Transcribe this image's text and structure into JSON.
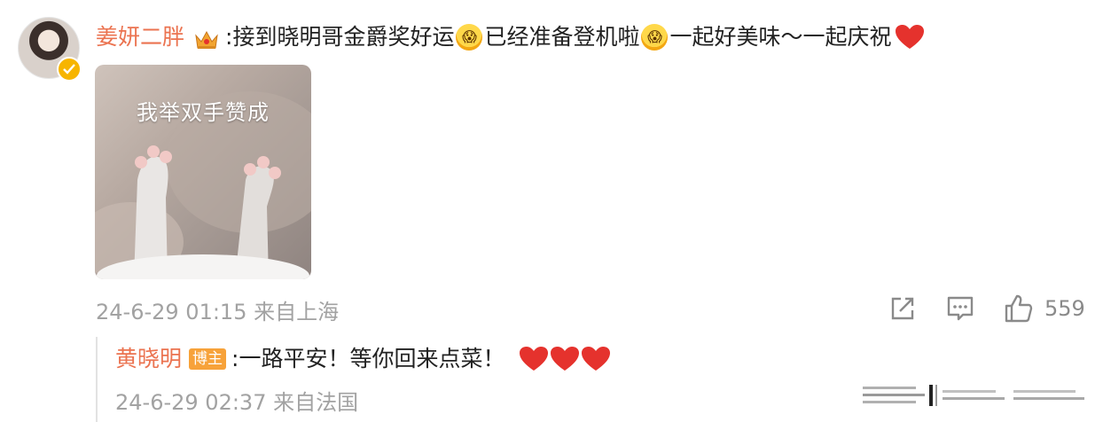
{
  "post": {
    "author": "姜妍二胖",
    "text_part1": ":接到晓明哥金爵奖好运",
    "text_part2": "已经准备登机啦",
    "text_part3": "一起好美味～一起庆祝",
    "emoji1": "😱",
    "emoji2": "😱",
    "image_caption": "我举双手赞成",
    "timestamp": "24-6-29 01:15",
    "location": "来自上海",
    "like_count": "559"
  },
  "reply": {
    "author": "黄晓明",
    "badge": "博主",
    "text": ":一路平安！等你回来点菜！",
    "timestamp": "24-6-29 02:37",
    "location": "来自法国"
  },
  "icons": {
    "share": "share-icon",
    "comment": "comment-icon",
    "like": "thumbs-up-icon",
    "verified": "verified-icon",
    "crown": "crown-icon",
    "heart": "heart-icon"
  },
  "colors": {
    "username": "#eb7350",
    "badge": "#f7a23a",
    "meta": "#a2a2a2",
    "heart": "#e5322d",
    "verified": "#f7b500"
  }
}
